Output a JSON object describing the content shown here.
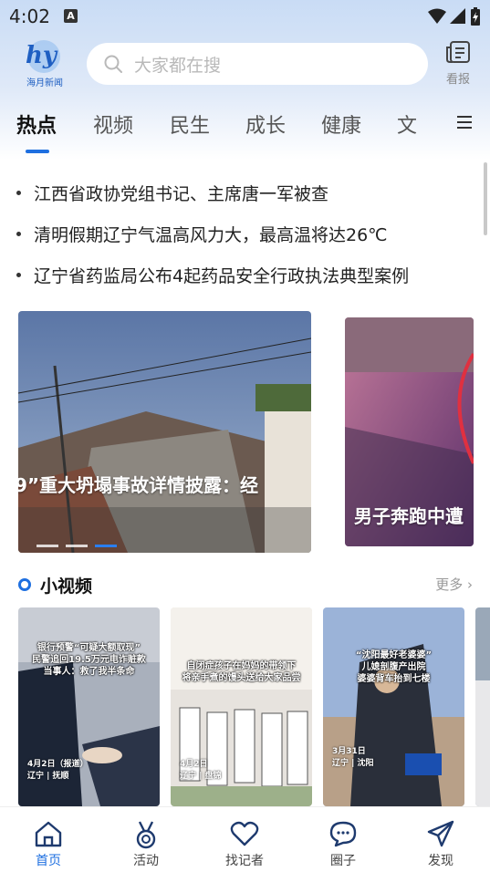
{
  "status_bar": {
    "time": "4:02",
    "indicator": "A"
  },
  "header": {
    "logo_text": "海月新闻",
    "search_placeholder": "大家都在搜",
    "newspaper_label": "看报"
  },
  "tabs": [
    {
      "label": "热点",
      "active": true
    },
    {
      "label": "视频"
    },
    {
      "label": "民生"
    },
    {
      "label": "成长"
    },
    {
      "label": "健康"
    },
    {
      "label": "文"
    }
  ],
  "headlines": [
    "江西省政协党组书记、主席唐一军被查",
    "清明假期辽宁气温高风力大，最高温将达26℃",
    "辽宁省药监局公布4起药品安全行政执法典型案例"
  ],
  "carousel": {
    "main_caption": "9”重大坍塌事故详情披露：经",
    "side_caption": "男子奔跑中遭"
  },
  "small_video": {
    "title": "小视频",
    "more": "更多",
    "items": [
      {
        "text": "银行预警“可疑大额取现”\n民警追回19.5万元电诈赃款\n当事人：救了我半条命",
        "tag": "4月2日（报道）\n辽宁 | 抚顺"
      },
      {
        "text": "自闭症孩子在妈妈的带领下\n将亲手煮的馒头送给大家品尝",
        "tag": "4月2日\n辽宁 | 盘锦"
      },
      {
        "text": "“沈阳最好老婆婆”\n儿媳剖腹产出院\n婆婆背车抬到七楼",
        "tag": "3月31日\n辽宁 | 沈阳"
      }
    ]
  },
  "bottom_nav": [
    {
      "label": "首页",
      "active": true
    },
    {
      "label": "活动"
    },
    {
      "label": "找记者"
    },
    {
      "label": "圈子"
    },
    {
      "label": "发现"
    }
  ],
  "colors": {
    "accent": "#1e6fe0",
    "header_bg": "#c9dcf5"
  }
}
